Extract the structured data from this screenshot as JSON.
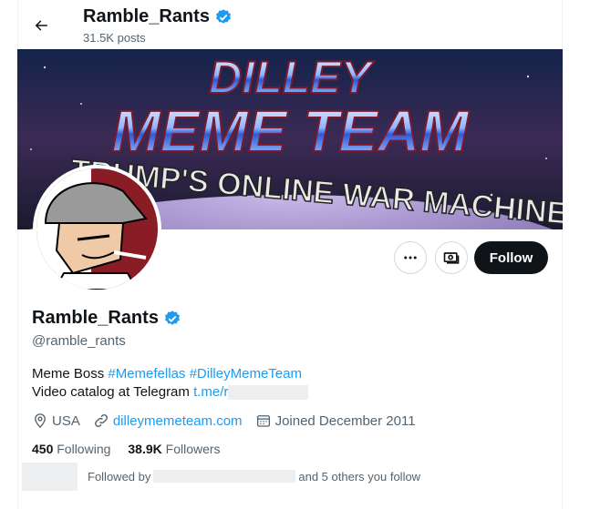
{
  "header": {
    "name": "Ramble_Rants",
    "posts": "31.5K posts"
  },
  "banner": {
    "line1": "DILLEY",
    "line2": "MEME TEAM",
    "line3": "TRUMP'S ONLINE WAR MACHINE"
  },
  "actions": {
    "follow_label": "Follow"
  },
  "profile": {
    "name": "Ramble_Rants",
    "handle": "@ramble_rants",
    "bio_prefix": "Meme Boss",
    "hashtag1": "#Memefellas",
    "hashtag2": "#DilleyMemeTeam",
    "bio_line2": "Video catalog at Telegram",
    "telegram_link": "t.me/r",
    "location": "USA",
    "website": "dilleymemeteam.com",
    "joined": "Joined December 2011"
  },
  "stats": {
    "following_count": "450",
    "following_label": "Following",
    "followers_count": "38.9K",
    "followers_label": "Followers"
  },
  "followed_by": {
    "prefix": "Followed by",
    "suffix": "and 5 others you follow"
  },
  "colors": {
    "accent": "#1d9bf0",
    "text": "#0f1419",
    "muted": "#536471"
  }
}
